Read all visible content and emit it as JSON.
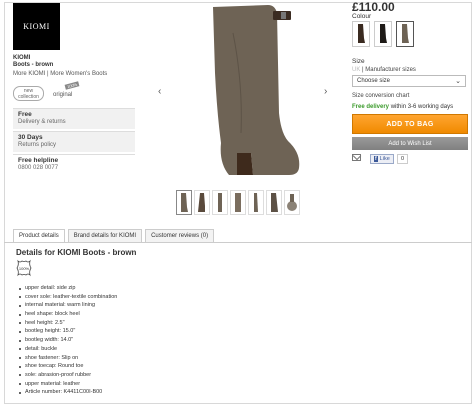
{
  "brand": {
    "logo_text": "KIOMI",
    "name": "KIOMI",
    "product": "Boots - brown",
    "more_brand": "More KIOMI",
    "separator": "|",
    "more_category": "More Women's Boots"
  },
  "badges": {
    "new_collection": "new collection",
    "original": "original",
    "stamp": "100%"
  },
  "info_boxes": [
    {
      "title": "Free",
      "subtitle": "Delivery & returns"
    },
    {
      "title": "30 Days",
      "subtitle": "Returns policy"
    },
    {
      "title": "Free helpline",
      "subtitle": "0800 028 0077"
    }
  ],
  "gallery": {
    "prev": "‹",
    "next": "›",
    "thumb_count": 7
  },
  "price": "£110.00",
  "colour": {
    "label": "Colour",
    "options": [
      "dark brown",
      "black",
      "brown"
    ]
  },
  "size": {
    "label": "Size",
    "uk": "UK",
    "manufacturer": "| Manufacturer sizes",
    "select_placeholder": "Choose size",
    "chart_link": "Size conversion chart"
  },
  "delivery": {
    "highlight": "Free delivery",
    "rest": "within 3-6 working days"
  },
  "actions": {
    "add_to_bag": "ADD TO BAG",
    "wish_list": "Add to Wish List"
  },
  "social": {
    "like": "Like",
    "count": "0"
  },
  "tabs": [
    "Product details",
    "Brand details for KIOMI",
    "Customer reviews (0)"
  ],
  "details": {
    "title": "Details for KIOMI Boots - brown",
    "leather_label": "100%",
    "specs": [
      "upper detail: side zip",
      "cover sole: leather-textile combination",
      "internal material: warm lining",
      "heel shape: block heel",
      "heel height: 2.5\"",
      "bootleg height: 15.0\"",
      "bootleg width: 14.0\"",
      "detail: buckle",
      "shoe fastener: Slip on",
      "shoe toecap: Round toe",
      "sole: abrasion-proof rubber",
      "upper material: leather",
      "Article number: K4411C00I-B00"
    ]
  },
  "colors": {
    "boot": "#6e6355",
    "orange": "#f59a1c",
    "green": "#3a9a2a"
  }
}
